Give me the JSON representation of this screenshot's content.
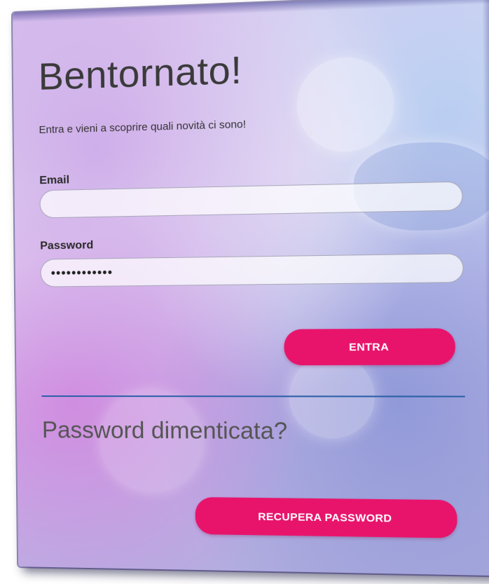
{
  "login": {
    "title": "Bentornato!",
    "subtitle": "Entra e vieni a scoprire quali novità ci sono!",
    "email_label": "Email",
    "email_value": "",
    "password_label": "Password",
    "password_value": "••••••••••••",
    "submit_label": "ENTRA"
  },
  "recovery": {
    "title": "Password dimenticata?",
    "button_label": "RECUPERA PASSWORD"
  },
  "colors": {
    "accent": "#e8146c",
    "divider": "#2b5fa8",
    "text": "#3a3a3a"
  }
}
